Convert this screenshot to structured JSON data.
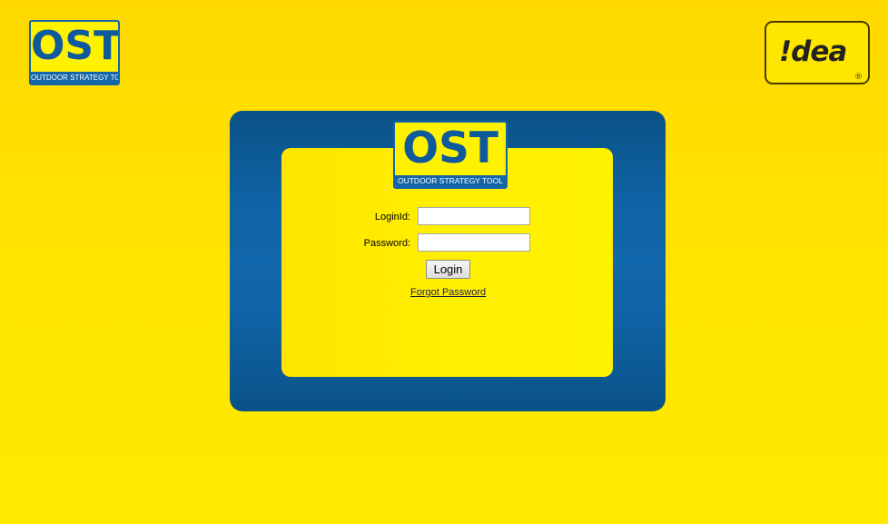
{
  "header": {
    "ost_logo": {
      "letters": "OST",
      "tagline": "OUTDOOR STRATEGY TOOL"
    },
    "idea_logo": {
      "text": "!dea",
      "registered_mark": "®"
    }
  },
  "login_panel": {
    "logo": {
      "letters": "OST",
      "tagline": "OUTDOOR STRATEGY TOOL"
    },
    "loginid": {
      "label": "LoginId:",
      "value": "",
      "placeholder": ""
    },
    "password": {
      "label": "Password:",
      "value": "",
      "placeholder": ""
    },
    "login_button_label": "Login",
    "forgot_password_label": "Forgot Password"
  },
  "colors": {
    "background": "#ffe000",
    "panel_blue": "#0f62a4",
    "logo_blue": "#1466a8",
    "logo_yellow": "#fff200"
  }
}
